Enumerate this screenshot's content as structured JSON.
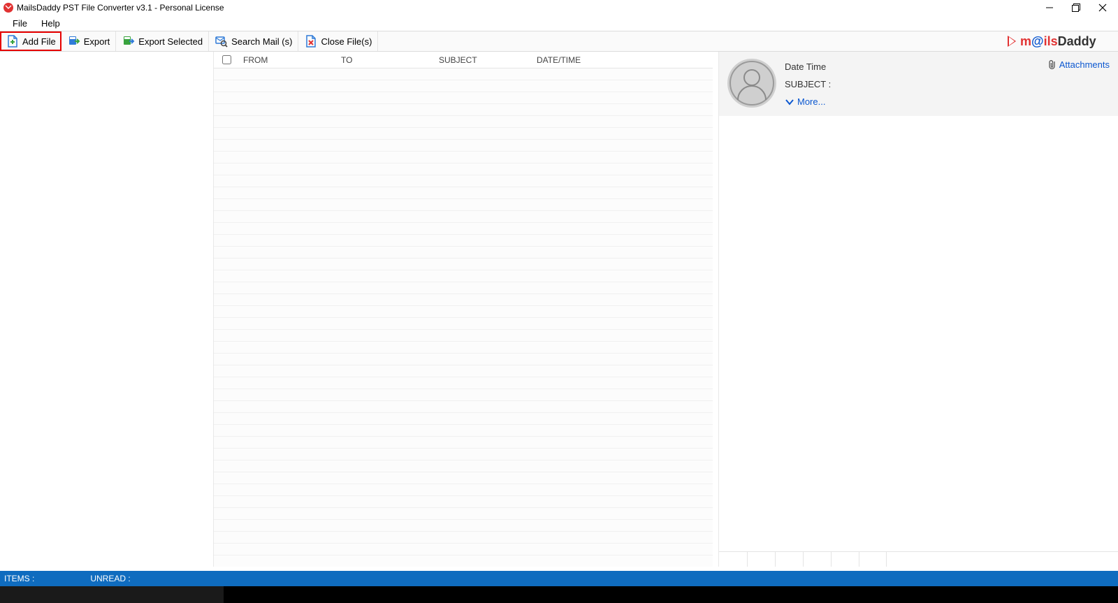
{
  "window": {
    "title": "MailsDaddy PST File Converter v3.1 - Personal License"
  },
  "menu": {
    "file": "File",
    "help": "Help"
  },
  "toolbar": {
    "add_file": "Add File",
    "export": "Export",
    "export_selected": "Export Selected",
    "search_mail": "Search Mail (s)",
    "close_files": "Close File(s)"
  },
  "grid": {
    "header": {
      "from": "FROM",
      "to": "TO",
      "subject": "SUBJECT",
      "datetime": "DATE/TIME"
    }
  },
  "preview": {
    "datetime_label": "Date Time",
    "subject_label": "SUBJECT :",
    "more": "More...",
    "attachments": "Attachments"
  },
  "status": {
    "items": "ITEMS :",
    "unread": "UNREAD :"
  }
}
